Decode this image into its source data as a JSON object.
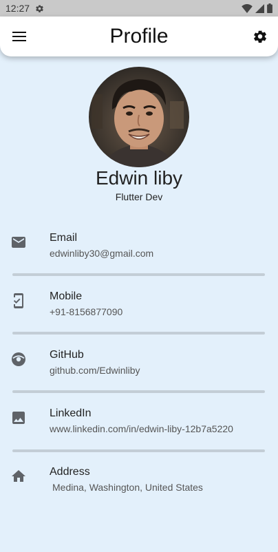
{
  "status_bar": {
    "time": "12:27",
    "icons": [
      "settings-gear-icon",
      "wifi-icon",
      "signal-icon",
      "battery-icon"
    ]
  },
  "app_bar": {
    "title": "Profile",
    "left_icon": "menu-icon",
    "right_icon": "settings-icon"
  },
  "profile": {
    "name": "Edwin liby",
    "role": "Flutter Dev"
  },
  "contacts": [
    {
      "icon": "email-icon",
      "label": "Email",
      "value": "edwinliby30@gmail.com"
    },
    {
      "icon": "mobile-icon",
      "label": "Mobile",
      "value": "+91-8156877090"
    },
    {
      "icon": "github-icon",
      "label": "GitHub",
      "value": "github.com/Edwinliby"
    },
    {
      "icon": "image-icon",
      "label": "LinkedIn",
      "value": "www.linkedin.com/in/edwin-liby-12b7a5220"
    },
    {
      "icon": "home-icon",
      "label": "Address",
      "value": "Medina, Washington, United States"
    }
  ],
  "colors": {
    "background": "#E3F0FB",
    "app_bar": "#FFFFFF",
    "status_bar": "#C9C9C9",
    "icon_gray": "#5F6368",
    "divider": "#C3CDD6"
  }
}
